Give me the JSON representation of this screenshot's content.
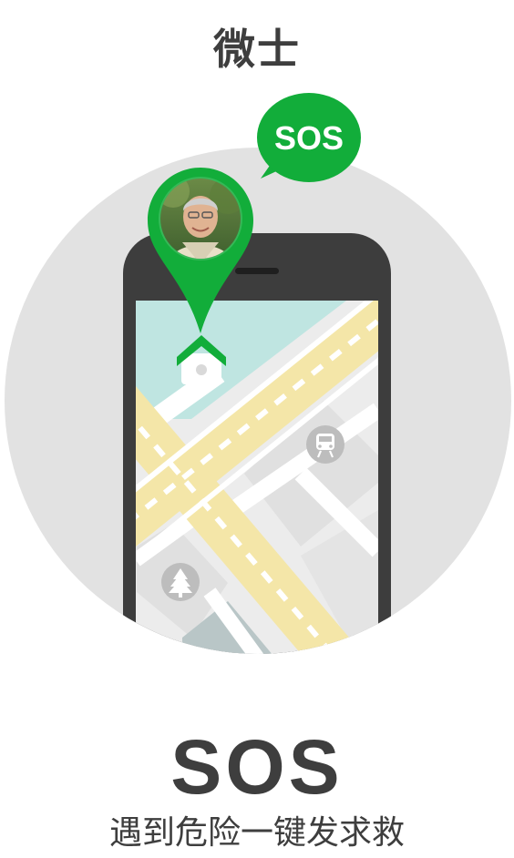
{
  "app_title": "微士",
  "bubble_label": "SOS",
  "headline": "SOS",
  "subtitle": "遇到危险一键发求救",
  "colors": {
    "brand_green": "#12ad3a",
    "circle_bg": "#e2e2e2",
    "phone_body": "#3d3d3d",
    "text_dark": "#3e3e3e",
    "map_bg": "#ececec",
    "map_water": "#bfe5e1",
    "road_yellow": "#f4e6a8"
  },
  "icons": [
    "chat-bubble-icon",
    "location-pin-icon",
    "home-icon",
    "train-icon",
    "tree-icon"
  ]
}
